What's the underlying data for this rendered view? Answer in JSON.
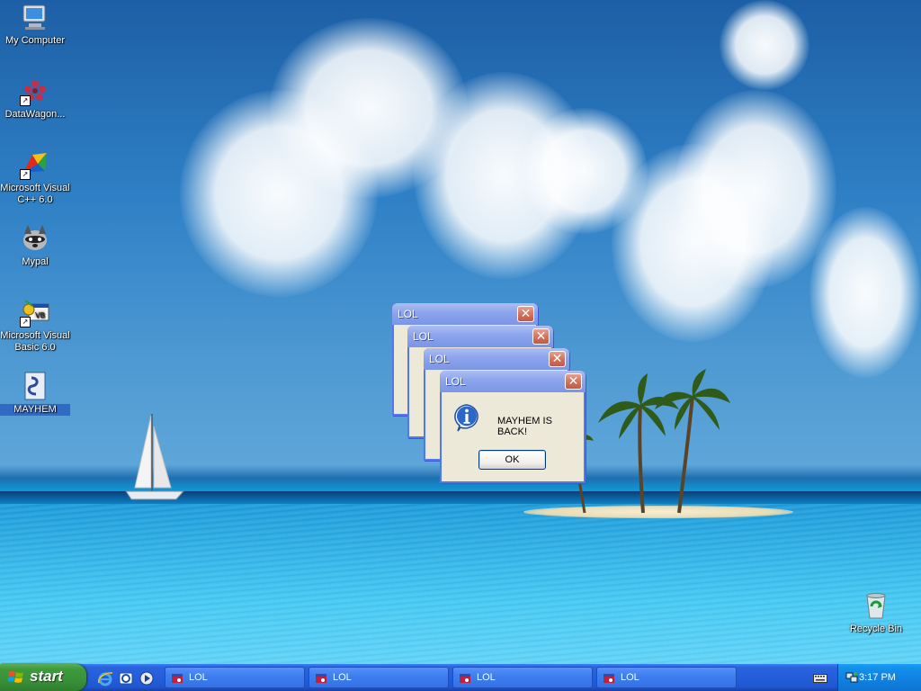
{
  "desktop": {
    "icons": [
      {
        "label": "My Computer",
        "icon": "my-computer-icon"
      },
      {
        "label": "DataWagon...",
        "icon": "datawagon-icon"
      },
      {
        "label": "Microsoft Visual C++ 6.0",
        "icon": "visual-cpp-icon"
      },
      {
        "label": "Mypal",
        "icon": "mypal-raccoon-icon"
      },
      {
        "label": "Microsoft Visual Basic 6.0",
        "icon": "visual-basic-icon"
      },
      {
        "label": "MAYHEM",
        "icon": "script-file-icon"
      },
      {
        "label": "Recycle Bin",
        "icon": "recycle-bin-icon"
      }
    ]
  },
  "dialogs": [
    {
      "title": "LOL",
      "message": "MAYHEM IS BACK!",
      "button": "OK",
      "close": "✕"
    },
    {
      "title": "LOL",
      "message": "MAYHEM IS BACK!",
      "button": "OK",
      "close": "✕"
    },
    {
      "title": "LOL",
      "message": "MAYHEM IS BACK!",
      "button": "OK",
      "close": "✕"
    },
    {
      "title": "LOL",
      "message": "MAYHEM IS BACK!",
      "button": "OK",
      "close": "✕"
    }
  ],
  "taskbar": {
    "start_label": "start",
    "quick_launch": [
      "internet-explorer-icon",
      "outlook-express-icon",
      "media-player-icon"
    ],
    "tasks": [
      {
        "label": "LOL"
      },
      {
        "label": "LOL"
      },
      {
        "label": "LOL"
      },
      {
        "label": "LOL"
      }
    ],
    "clock": "3:17 PM"
  },
  "colors": {
    "taskbar_blue": "#245edb",
    "start_green": "#3c9b3c",
    "dialog_face": "#ece9d8",
    "title_blue": "#7b95e6",
    "close_red": "#d6735f"
  }
}
